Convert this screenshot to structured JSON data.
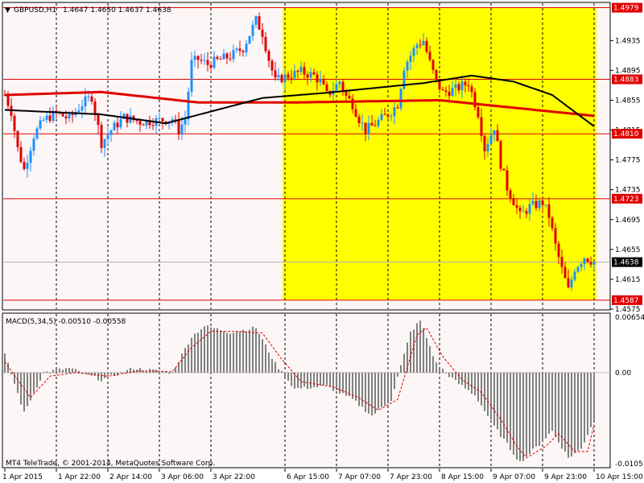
{
  "header": {
    "symbol": "GBPUSD,H1",
    "ohlc": "1.4647 1.4650 1.4637 1.4638"
  },
  "macd": {
    "title": "MACD(5,34,5) -0.00510 -0.00558",
    "ticks": [
      "0.00654",
      "0.00",
      "-0.01051"
    ]
  },
  "copyright": "MT4 TeleTrade, © 2001-2014, MetaQuotes Software Corp.",
  "colors": {
    "background": "#fcf6f6",
    "highlight": "#ffff00",
    "level_line": "#e00000",
    "ma_slow": "#e00000",
    "ma_fast": "#000000",
    "candle_up": "#1e90ff",
    "candle_down": "#e00000",
    "macd_hist": "#808080",
    "macd_signal": "#e00000"
  },
  "chart_data": {
    "type": "candlestick",
    "price_range": [
      1.4575,
      1.4985
    ],
    "price_ticks": [
      "1.4935",
      "1.4895",
      "1.4855",
      "1.4815",
      "1.4775",
      "1.4735",
      "1.4695",
      "1.4655",
      "1.4615",
      "1.4575"
    ],
    "levels": [
      "1.4979",
      "1.4883",
      "1.4810",
      "1.4723",
      "1.4587"
    ],
    "current_price": "1.4638",
    "time_labels": [
      "1 Apr 2015",
      "1 Apr 22:00",
      "2 Apr 14:00",
      "3 Apr 06:00",
      "3 Apr 22:00",
      "6 Apr 15:00",
      "7 Apr 07:00",
      "7 Apr 23:00",
      "8 Apr 15:00",
      "9 Apr 07:00",
      "9 Apr 23:00",
      "10 Apr 15:00"
    ],
    "highlight_range": [
      "6 Apr 15:00",
      "10 Apr 15:00"
    ],
    "anchors": [
      [
        0,
        1.4862
      ],
      [
        2,
        1.484
      ],
      [
        4,
        1.479
      ],
      [
        6,
        1.4762
      ],
      [
        9,
        1.4808
      ],
      [
        12,
        1.4828
      ],
      [
        16,
        1.4838
      ],
      [
        20,
        1.483
      ],
      [
        24,
        1.485
      ],
      [
        27,
        1.486
      ],
      [
        30,
        1.4798
      ],
      [
        33,
        1.4815
      ],
      [
        37,
        1.4832
      ],
      [
        42,
        1.4826
      ],
      [
        48,
        1.4828
      ],
      [
        52,
        1.483
      ],
      [
        54,
        1.4815
      ],
      [
        56,
        1.483
      ],
      [
        58,
        1.4905
      ],
      [
        60,
        1.491
      ],
      [
        63,
        1.4903
      ],
      [
        66,
        1.4908
      ],
      [
        70,
        1.4914
      ],
      [
        74,
        1.4925
      ],
      [
        78,
        1.4962
      ],
      [
        80,
        1.4945
      ],
      [
        82,
        1.491
      ],
      [
        84,
        1.488
      ],
      [
        86,
        1.4885
      ],
      [
        88,
        1.4888
      ],
      [
        92,
        1.4893
      ],
      [
        96,
        1.4888
      ],
      [
        98,
        1.488
      ],
      [
        100,
        1.4862
      ],
      [
        102,
        1.487
      ],
      [
        104,
        1.488
      ],
      [
        106,
        1.486
      ],
      [
        108,
        1.485
      ],
      [
        110,
        1.483
      ],
      [
        112,
        1.4815
      ],
      [
        114,
        1.482
      ],
      [
        117,
        1.483
      ],
      [
        120,
        1.484
      ],
      [
        122,
        1.485
      ],
      [
        124,
        1.49
      ],
      [
        126,
        1.4915
      ],
      [
        128,
        1.493
      ],
      [
        130,
        1.4935
      ],
      [
        132,
        1.4905
      ],
      [
        134,
        1.488
      ],
      [
        136,
        1.4865
      ],
      [
        140,
        1.487
      ],
      [
        144,
        1.4878
      ],
      [
        147,
        1.4838
      ],
      [
        149,
        1.479
      ],
      [
        152,
        1.482
      ],
      [
        154,
        1.477
      ],
      [
        156,
        1.4738
      ],
      [
        158,
        1.472
      ],
      [
        160,
        1.47
      ],
      [
        163,
        1.4712
      ],
      [
        167,
        1.4718
      ],
      [
        169,
        1.47
      ],
      [
        171,
        1.466
      ],
      [
        173,
        1.4628
      ],
      [
        175,
        1.46
      ],
      [
        177,
        1.463
      ],
      [
        180,
        1.4645
      ],
      [
        183,
        1.4638
      ]
    ],
    "ma_slow": [
      [
        0,
        1.4862
      ],
      [
        30,
        1.4866
      ],
      [
        60,
        1.4852
      ],
      [
        90,
        1.4852
      ],
      [
        135,
        1.4855
      ],
      [
        183,
        1.4834
      ]
    ],
    "ma_fast": [
      [
        0,
        1.4842
      ],
      [
        30,
        1.4836
      ],
      [
        50,
        1.4824
      ],
      [
        80,
        1.4858
      ],
      [
        100,
        1.4865
      ],
      [
        130,
        1.4878
      ],
      [
        145,
        1.4888
      ],
      [
        158,
        1.488
      ],
      [
        170,
        1.4862
      ],
      [
        183,
        1.482
      ]
    ],
    "macd_range": [
      -0.01051,
      0.00654
    ],
    "macd_hist": [
      [
        0,
        0.002
      ],
      [
        6,
        -0.0045
      ],
      [
        12,
        0.0
      ],
      [
        20,
        0.0005
      ],
      [
        30,
        -0.0008
      ],
      [
        40,
        0.0005
      ],
      [
        52,
        0.0
      ],
      [
        58,
        0.004
      ],
      [
        62,
        0.0052
      ],
      [
        70,
        0.0045
      ],
      [
        78,
        0.005
      ],
      [
        84,
        0.001
      ],
      [
        90,
        -0.0018
      ],
      [
        100,
        -0.0015
      ],
      [
        108,
        -0.003
      ],
      [
        114,
        -0.0048
      ],
      [
        120,
        -0.003
      ],
      [
        126,
        0.0045
      ],
      [
        129,
        0.0058
      ],
      [
        134,
        0.001
      ],
      [
        140,
        -0.001
      ],
      [
        146,
        -0.0025
      ],
      [
        152,
        -0.006
      ],
      [
        157,
        -0.0085
      ],
      [
        160,
        -0.01
      ],
      [
        166,
        -0.008
      ],
      [
        170,
        -0.0065
      ],
      [
        175,
        -0.0095
      ],
      [
        179,
        -0.0085
      ],
      [
        183,
        -0.0052
      ]
    ],
    "macd_signal": [
      [
        0,
        0.0012
      ],
      [
        8,
        -0.0028
      ],
      [
        14,
        -0.0004
      ],
      [
        22,
        0.0
      ],
      [
        32,
        -0.0004
      ],
      [
        42,
        0.0002
      ],
      [
        52,
        0.0001
      ],
      [
        58,
        0.0028
      ],
      [
        64,
        0.0046
      ],
      [
        72,
        0.0046
      ],
      [
        80,
        0.0044
      ],
      [
        86,
        0.0015
      ],
      [
        92,
        -0.001
      ],
      [
        102,
        -0.0016
      ],
      [
        110,
        -0.0028
      ],
      [
        116,
        -0.0042
      ],
      [
        122,
        -0.003
      ],
      [
        128,
        0.0042
      ],
      [
        131,
        0.005
      ],
      [
        136,
        0.0018
      ],
      [
        142,
        -0.0008
      ],
      [
        148,
        -0.0022
      ],
      [
        154,
        -0.0052
      ],
      [
        159,
        -0.0082
      ],
      [
        162,
        -0.0095
      ],
      [
        168,
        -0.0082
      ],
      [
        172,
        -0.0068
      ],
      [
        177,
        -0.0088
      ],
      [
        181,
        -0.0088
      ],
      [
        183,
        -0.0058
      ]
    ]
  }
}
